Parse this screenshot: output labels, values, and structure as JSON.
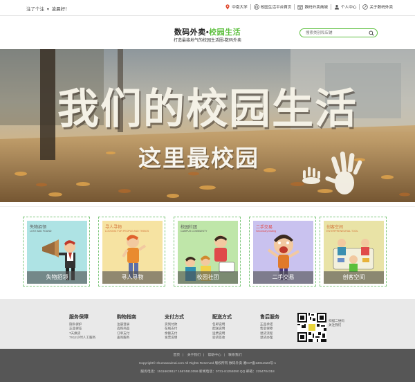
{
  "topbar": {
    "greeting": "注了个注",
    "greeting_suffix": "凌晨好！",
    "links": [
      {
        "icon": "location-pin-icon",
        "label": "中南大学"
      },
      {
        "icon": "campus-home-icon",
        "label": "校园生活平台首页"
      },
      {
        "icon": "store-icon",
        "label": "数码外卖商城"
      },
      {
        "icon": "user-icon",
        "label": "个人中心"
      },
      {
        "icon": "info-icon",
        "label": "关于数码外卖"
      }
    ]
  },
  "header": {
    "brand_main": "数码外卖",
    "brand_dot": "•",
    "brand_green": "校园生活",
    "slogan": "打造最接地气的校园生活圈-数码外卖",
    "search_placeholder": "搜索类别和店铺"
  },
  "banner": {
    "title": "我们的校园生活",
    "subtitle": "这里最校园"
  },
  "categories": [
    {
      "name": "失物招领",
      "tag": "失物招领",
      "tag_en": "LOST AND FOUND",
      "bg": "#aee3e4"
    },
    {
      "name": "寻人寻物",
      "tag": "寻人寻物",
      "tag_en": "LOOKING FOR PEOPLE AND THINGS",
      "bg": "#f6e3a2"
    },
    {
      "name": "校园社团",
      "tag": "校园社团",
      "tag_en": "CAMPUS COMMUNITY",
      "bg": "#bfe6a9"
    },
    {
      "name": "二手交易",
      "tag": "二手交易",
      "tag_en": "Secondary trading",
      "bg": "#c9c2ef"
    },
    {
      "name": "创客空间",
      "tag": "创客空间",
      "tag_en": "ENTERPRENEURIAL TOOL",
      "bg": "#e9e3a6"
    }
  ],
  "footer": {
    "columns": [
      {
        "title": "服务保障",
        "items": [
          "隐私保护",
          "正品保证",
          "7天换货",
          "7X12小时人工服务"
        ]
      },
      {
        "title": "购物指南",
        "items": [
          "注册登录",
          "选购商品",
          "订单支付",
          "查询服务"
        ]
      },
      {
        "title": "支付方式",
        "items": [
          "货到付款",
          "在线支付",
          "余额支付",
          "发票说明"
        ]
      },
      {
        "title": "配送方式",
        "items": [
          "包邮说明",
          "配送说明",
          "运费说明",
          "验货签收"
        ]
      },
      {
        "title": "售后服务",
        "items": [
          "正品承诺",
          "售后保障",
          "退货流程",
          "退货办理"
        ]
      }
    ],
    "qr_caption": [
      "扫描二维码",
      "关注我们"
    ],
    "nav": [
      "首页",
      "关于我们",
      "帮助中心",
      "联系我们"
    ],
    "copyright": "Copyright© shumawaimai.com  All Rights Reserved 版权所有 数码外卖 湘ICP备13011523号-1",
    "contact": "服务电话：15116639117  15674813059    新闻电话：0731-81259390    QQ 邮箱：2254704318"
  }
}
